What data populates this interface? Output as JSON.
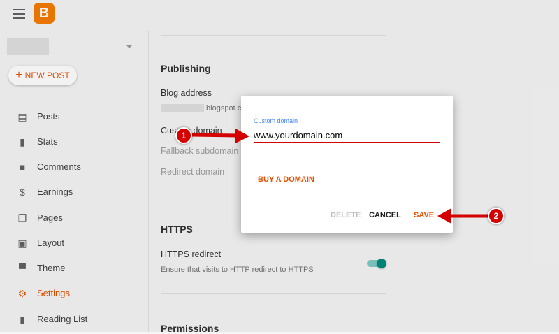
{
  "app": {
    "logo_letter": "B"
  },
  "sidebar": {
    "new_post_label": "NEW POST",
    "items": [
      {
        "label": "Posts",
        "icon": "posts-icon",
        "glyph": "▤"
      },
      {
        "label": "Stats",
        "icon": "stats-icon",
        "glyph": "▮"
      },
      {
        "label": "Comments",
        "icon": "comments-icon",
        "glyph": "■"
      },
      {
        "label": "Earnings",
        "icon": "earnings-icon",
        "glyph": "$"
      },
      {
        "label": "Pages",
        "icon": "pages-icon",
        "glyph": "❐"
      },
      {
        "label": "Layout",
        "icon": "layout-icon",
        "glyph": "▣"
      },
      {
        "label": "Theme",
        "icon": "theme-icon",
        "glyph": "▀"
      },
      {
        "label": "Settings",
        "icon": "settings-icon",
        "glyph": "⚙",
        "active": true
      },
      {
        "label": "Reading List",
        "icon": "reading-list-icon",
        "glyph": "▮"
      }
    ]
  },
  "content": {
    "publishing": {
      "title": "Publishing",
      "blog_address_label": "Blog address",
      "blog_address_suffix": ".blogspot.co",
      "custom_domain_label": "Custom domain",
      "fallback_subdomain_label": "Fallback subdomain",
      "redirect_domain_label": "Redirect domain"
    },
    "https": {
      "title": "HTTPS",
      "redirect_label": "HTTPS redirect",
      "redirect_description": "Ensure that visits to HTTP redirect to HTTPS",
      "redirect_enabled": true
    },
    "permissions": {
      "title": "Permissions"
    }
  },
  "dialog": {
    "label": "Custom domain",
    "input_value": "www.yourdomain.com",
    "buy_domain_label": "BUY A DOMAIN",
    "delete_label": "DELETE",
    "cancel_label": "CANCEL",
    "save_label": "SAVE"
  },
  "annotations": [
    {
      "number": "1"
    },
    {
      "number": "2"
    }
  ],
  "colors": {
    "accent": "#e65100",
    "brand": "#f57c00",
    "arrow": "#d50000",
    "toggle": "#00897b"
  }
}
